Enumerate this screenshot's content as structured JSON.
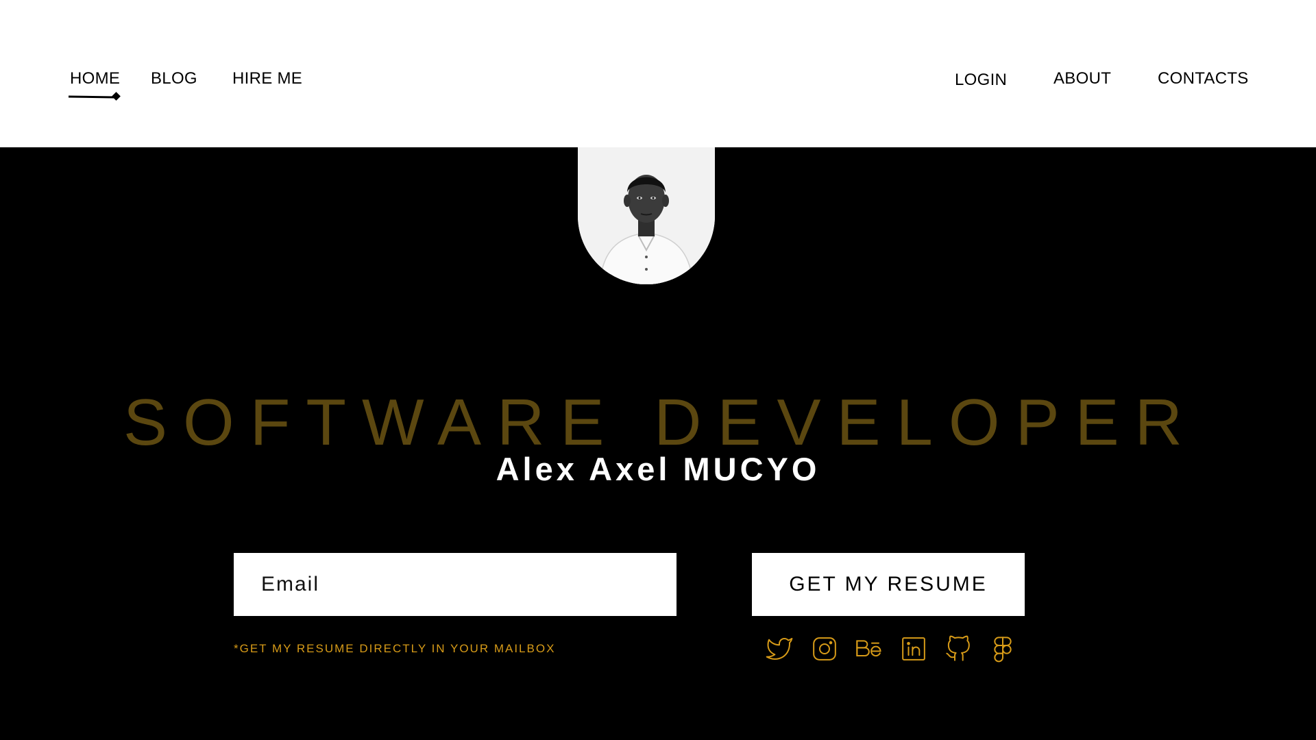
{
  "nav": {
    "left_links": [
      "HOME",
      "BLOG",
      "HIRE ME"
    ],
    "right_links": [
      "LOGIN",
      "ABOUT",
      "CONTACTS"
    ],
    "active": "HOME"
  },
  "hero": {
    "role": "SOFTWARE DEVELOPER",
    "name": "Alex Axel MUCYO"
  },
  "form": {
    "email_placeholder": "Email",
    "button_label": "GET MY RESUME",
    "hint": "*GET MY RESUME DIRECTLY IN YOUR MAILBOX"
  },
  "social": [
    "twitter-icon",
    "instagram-icon",
    "behance-icon",
    "linkedin-icon",
    "github-icon",
    "figma-icon"
  ],
  "colors": {
    "accent": "#d79b18",
    "role_text": "#5b4710",
    "background": "#000000",
    "nav_background": "#ffffff"
  }
}
